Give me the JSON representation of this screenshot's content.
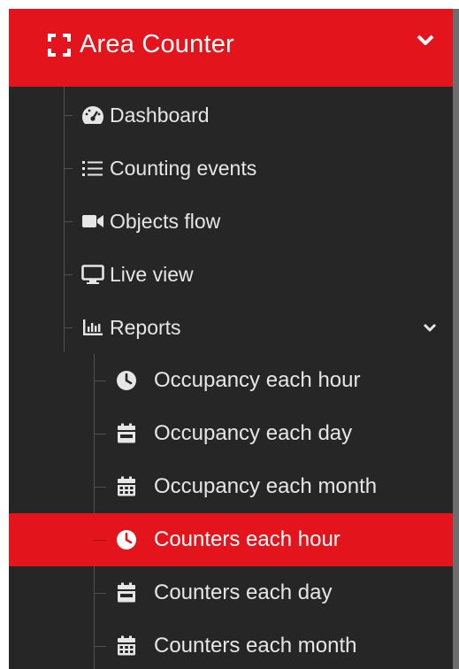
{
  "header": {
    "title": "Area Counter",
    "icon": "focus-brackets-icon",
    "toggle_icon": "chevron-down-icon"
  },
  "menu": {
    "items": [
      {
        "label": "Dashboard",
        "icon": "dashboard-gauge-icon"
      },
      {
        "label": "Counting events",
        "icon": "list-icon"
      },
      {
        "label": "Objects flow",
        "icon": "video-camera-icon"
      },
      {
        "label": "Live view",
        "icon": "monitor-icon"
      },
      {
        "label": "Reports",
        "icon": "bar-chart-icon",
        "expanded": true
      }
    ],
    "reports": [
      {
        "label": "Occupancy each hour",
        "icon": "clock-icon"
      },
      {
        "label": "Occupancy each day",
        "icon": "calendar-day-icon"
      },
      {
        "label": "Occupancy each month",
        "icon": "calendar-month-icon"
      },
      {
        "label": "Counters each hour",
        "icon": "clock-icon",
        "active": true
      },
      {
        "label": "Counters each day",
        "icon": "calendar-day-icon"
      },
      {
        "label": "Counters each month",
        "icon": "calendar-month-icon"
      }
    ]
  },
  "colors": {
    "accent": "#e3141c",
    "sidebar_bg": "#262626",
    "text": "#e6e6e6"
  }
}
